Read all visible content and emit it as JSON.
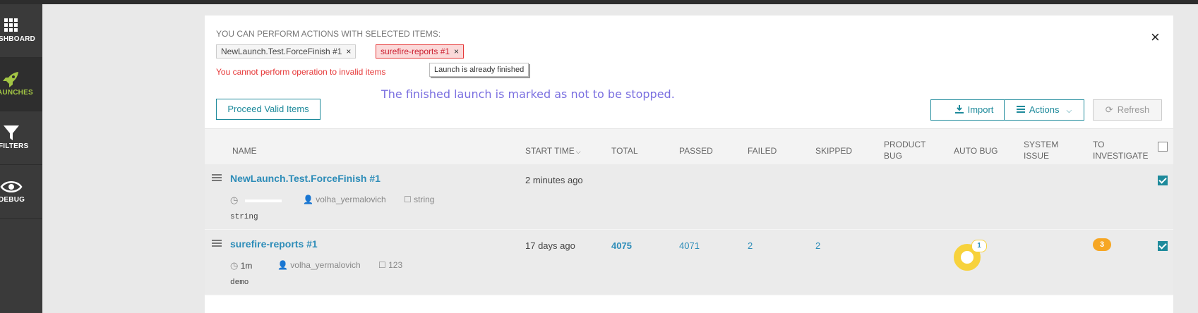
{
  "sidebar": {
    "items": [
      {
        "label": "SHBOARD",
        "icon": "grid-icon"
      },
      {
        "label": "AUNCHES",
        "icon": "rocket-icon"
      },
      {
        "label": "FILTERS",
        "icon": "funnel-icon"
      },
      {
        "label": "DEBUG",
        "icon": "eye-icon"
      }
    ]
  },
  "panel": {
    "actions_title": "YOU CAN PERFORM ACTIONS WITH SELECTED ITEMS:",
    "chips": [
      {
        "label": "NewLaunch.Test.ForceFinish #1",
        "remove": "×"
      },
      {
        "label": "surefire-reports #1",
        "remove": "×"
      }
    ],
    "error": "You cannot perform operation to invalid items",
    "tooltip": "Launch is already finished",
    "close": "×",
    "hint": "The finished launch is marked as not to be stopped.",
    "proceed_label": "Proceed Valid Items",
    "import_label": "Import",
    "actions_label": "Actions",
    "refresh_label": "Refresh"
  },
  "table": {
    "headers": {
      "name": "NAME",
      "start_time": "START TIME",
      "total": "TOTAL",
      "passed": "PASSED",
      "failed": "FAILED",
      "skipped": "SKIPPED",
      "product_bug_1": "PRODUCT",
      "product_bug_2": "BUG",
      "auto_bug": "AUTO BUG",
      "system_issue_1": "SYSTEM",
      "system_issue_2": "ISSUE",
      "to_investigate_1": "TO",
      "to_investigate_2": "INVESTIGATE"
    },
    "rows": [
      {
        "name": "NewLaunch.Test.ForceFinish #1",
        "duration": "",
        "owner": "volha_yermalovich",
        "tag": "string",
        "description": "string",
        "start": "2 minutes ago",
        "total": "",
        "passed": "",
        "failed": "",
        "skipped": "",
        "checked": true
      },
      {
        "name": "surefire-reports #1",
        "duration": "1m",
        "owner": "volha_yermalovich",
        "tag": "123",
        "description": "demo",
        "start": "17 days ago",
        "total": "4075",
        "passed": "4071",
        "failed": "2",
        "skipped": "2",
        "auto_bug_count": "1",
        "to_investigate": "3",
        "checked": true
      }
    ]
  },
  "colors": {
    "accent": "#1e8a9b",
    "link": "#2c8cb8",
    "error": "#e63838",
    "auto_bug": "#f7d23c",
    "to_investigate": "#f6a623"
  }
}
